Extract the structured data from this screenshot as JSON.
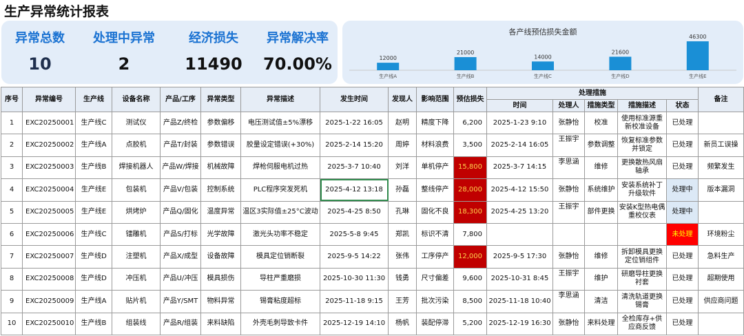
{
  "title": "生产异常统计报表",
  "kpis": [
    {
      "label": "异常总数",
      "value": "10"
    },
    {
      "label": "处理中异常",
      "value": "2"
    },
    {
      "label": "经济损失",
      "value": "11490"
    },
    {
      "label": "异常解决率",
      "value": "70.00%"
    }
  ],
  "chart_data": {
    "type": "bar",
    "title": "各产线预估损失金额",
    "categories": [
      "生产线A",
      "生产线B",
      "生产线C",
      "生产线D",
      "生产线E"
    ],
    "values": [
      12000,
      21000,
      14000,
      21600,
      46300
    ],
    "color": "#1a8fd6",
    "ylim": [
      0,
      46300
    ]
  },
  "table": {
    "headers": {
      "seq": "序号",
      "id": "异常编号",
      "line": "生产线",
      "device": "设备名称",
      "product": "产品/工序",
      "type": "异常类型",
      "desc": "异常描述",
      "time": "发生时间",
      "finder": "发现人",
      "impact": "影响范围",
      "loss": "预估损失",
      "measures": "处理措施",
      "m_time": "时间",
      "m_handler": "处理人",
      "m_type": "措施类型",
      "m_desc": "措施描述",
      "status": "状态",
      "remark": "备注"
    },
    "rows": [
      {
        "seq": "1",
        "id": "EXC20250001",
        "line": "生产线C",
        "device": "测试仪",
        "product": "产品Z/终检",
        "type": "参数偏移",
        "desc": "电压测试值±5%漂移",
        "time": "2025-1-22 16:05",
        "finder": "赵明",
        "impact": "精度下降",
        "loss": "6,200",
        "m_time": "2025-1-23 9:10",
        "m_handler": "张静怡",
        "m_type": "校准",
        "m_desc": "使用标准源重新校准设备",
        "status": "已处理",
        "remark": ""
      },
      {
        "seq": "2",
        "id": "EXC20250002",
        "line": "生产线A",
        "device": "点胶机",
        "product": "产品T/封装",
        "type": "参数错误",
        "desc": "胶量设定错误(+30%)",
        "time": "2025-2-14 15:20",
        "finder": "周婷",
        "impact": "材料浪费",
        "loss": "3,500",
        "m_time": "2025-2-14 16:05",
        "m_handler": "王振宇",
        "m_type": "参数调整",
        "m_desc": "恢复标准参数并锁定",
        "status": "已处理",
        "remark": "新员工误操"
      },
      {
        "seq": "3",
        "id": "EXC20250003",
        "line": "生产线B",
        "device": "焊接机器人",
        "product": "产品W/焊接",
        "type": "机械故障",
        "desc": "焊枪伺服电机过热",
        "time": "2025-3-7 10:40",
        "finder": "刘洋",
        "impact": "单机停产",
        "loss": "15,800",
        "m_time": "2025-3-7 14:15",
        "m_handler": "李思涵",
        "m_type": "维修",
        "m_desc": "更换散热风扇轴承",
        "status": "已处理",
        "remark": "频繁发生"
      },
      {
        "seq": "4",
        "id": "EXC20250004",
        "line": "生产线E",
        "device": "包装机",
        "product": "产品V/包装",
        "type": "控制系统",
        "desc": "PLC程序突发死机",
        "time": "2025-4-12 13:18",
        "finder": "孙磊",
        "impact": "整线停产",
        "loss": "28,000",
        "m_time": "2025-4-12 15:50",
        "m_handler": "张静怡",
        "m_type": "系统维护",
        "m_desc": "安装系统补丁升级软件",
        "status": "处理中",
        "remark": "版本漏洞"
      },
      {
        "seq": "5",
        "id": "EXC20250005",
        "line": "生产线E",
        "device": "烘烤炉",
        "product": "产品Q/固化",
        "type": "温度异常",
        "desc": "温区3实际值±25°C波动",
        "time": "2025-4-25 8:50",
        "finder": "孔琳",
        "impact": "固化不良",
        "loss": "18,300",
        "m_time": "2025-4-25 13:20",
        "m_handler": "王振宇",
        "m_type": "部件更换",
        "m_desc": "安装K型热电偶重校仪表",
        "status": "处理中",
        "remark": ""
      },
      {
        "seq": "6",
        "id": "EXC20250006",
        "line": "生产线C",
        "device": "镭雕机",
        "product": "产品S/打标",
        "type": "光学故障",
        "desc": "激光头功率不稳定",
        "time": "2025-5-8 9:45",
        "finder": "郑凯",
        "impact": "标识不清",
        "loss": "7,800",
        "m_time": "",
        "m_handler": "",
        "m_type": "",
        "m_desc": "",
        "status": "未处理",
        "remark": "环境粉尘"
      },
      {
        "seq": "7",
        "id": "EXC20250007",
        "line": "生产线D",
        "device": "注塑机",
        "product": "产品X/成型",
        "type": "设备故障",
        "desc": "模具定位销断裂",
        "time": "2025-9-5 14:22",
        "finder": "张伟",
        "impact": "工序停产",
        "loss": "12,000",
        "m_time": "2025-9-5 17:30",
        "m_handler": "张静怡",
        "m_type": "维修",
        "m_desc": "拆卸模具更换定位销组件",
        "status": "已处理",
        "remark": "急料生产"
      },
      {
        "seq": "8",
        "id": "EXC20250008",
        "line": "生产线D",
        "device": "冲压机",
        "product": "产品U/冲压",
        "type": "模具损伤",
        "desc": "导柱严重磨损",
        "time": "2025-10-30 11:30",
        "finder": "钱勇",
        "impact": "尺寸偏差",
        "loss": "9,600",
        "m_time": "2025-10-31 8:45",
        "m_handler": "王振宇",
        "m_type": "维护",
        "m_desc": "研磨导柱更换衬套",
        "status": "已处理",
        "remark": "超期使用"
      },
      {
        "seq": "9",
        "id": "EXC20250009",
        "line": "生产线A",
        "device": "贴片机",
        "product": "产品Y/SMT",
        "type": "物料异常",
        "desc": "锡膏粘度超标",
        "time": "2025-11-18 9:15",
        "finder": "王芳",
        "impact": "批次污染",
        "loss": "8,500",
        "m_time": "2025-11-18 10:40",
        "m_handler": "李思涵",
        "m_type": "清洁",
        "m_desc": "清洗轨道更换锡膏",
        "status": "已处理",
        "remark": "供应商问题"
      },
      {
        "seq": "10",
        "id": "EXC20250010",
        "line": "生产线B",
        "device": "组装线",
        "product": "产品R/组装",
        "type": "来料缺陷",
        "desc": "外壳毛刺导致卡件",
        "time": "2025-12-19 14:10",
        "finder": "杨帆",
        "impact": "装配停滞",
        "loss": "5,200",
        "m_time": "2025-12-19 16:30",
        "m_handler": "张静怡",
        "m_type": "来料处理",
        "m_desc": "全检库存+供应商反馈",
        "status": "已处理",
        "remark": ""
      }
    ]
  }
}
